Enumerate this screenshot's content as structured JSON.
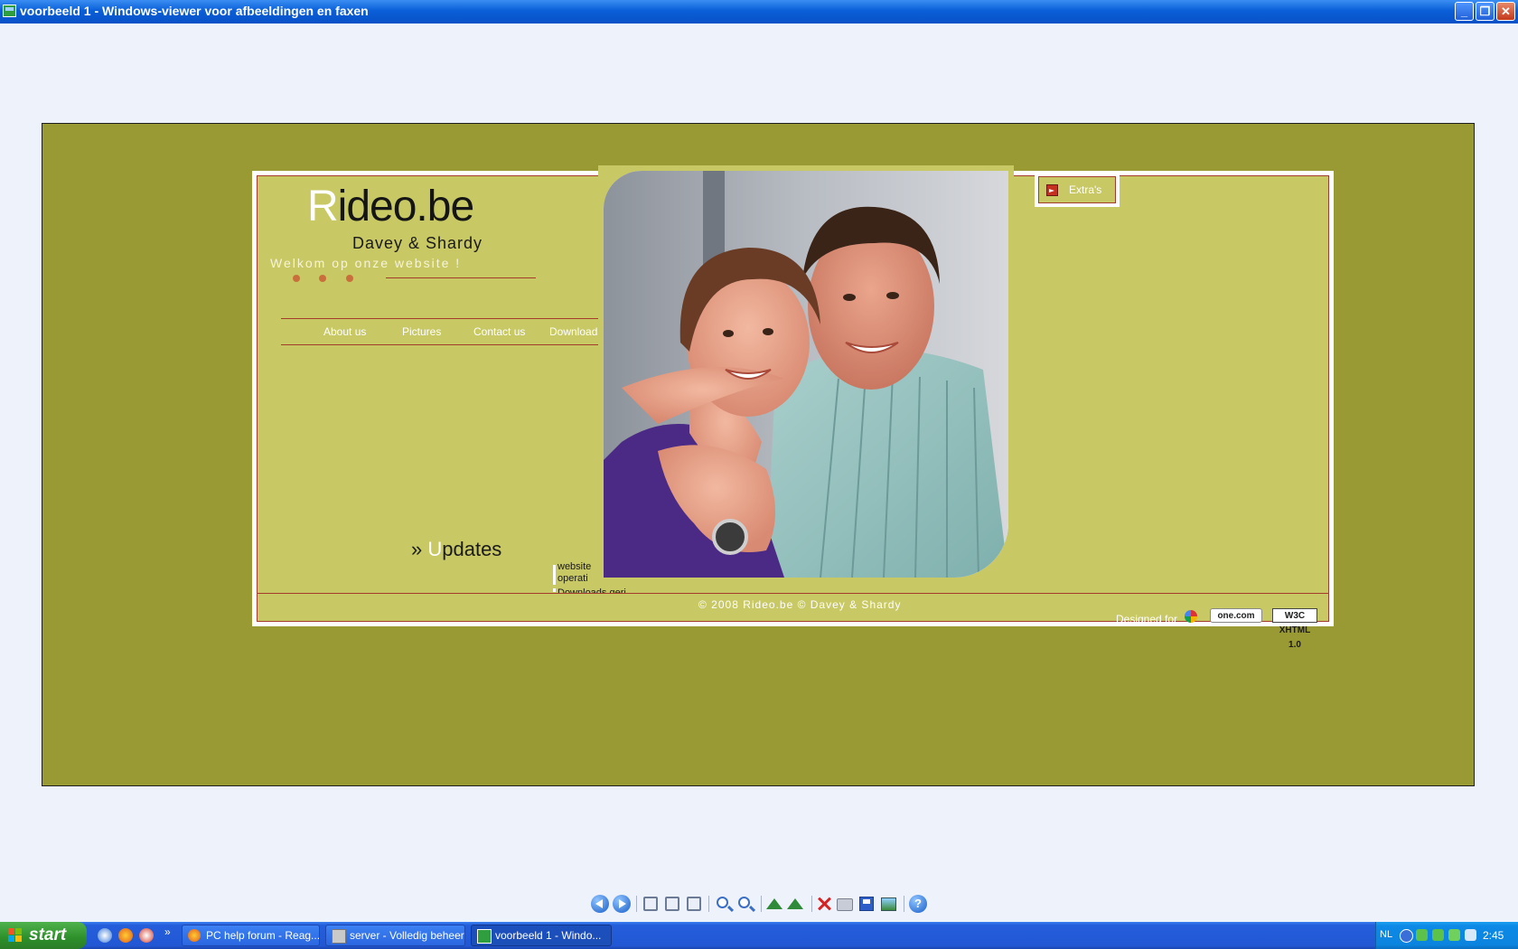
{
  "window": {
    "title": "voorbeeld 1 - Windows-viewer voor afbeeldingen en faxen",
    "minimize_glyph": "_",
    "restore_glyph": "❐",
    "close_glyph": "✕"
  },
  "website": {
    "logo_first": "R",
    "logo_rest": "ideo.be",
    "subtitle": "Davey & Shardy",
    "welcome": "Welkom op onze website !",
    "nav": [
      "About us",
      "Pictures",
      "Contact us",
      "Downloads"
    ],
    "extras_label": "Extra's",
    "updates_prefix": "» ",
    "updates_first": "U",
    "updates_rest": "pdates",
    "update_lines": [
      "website",
      "operati",
      "Downloads geri"
    ],
    "copyright": "© 2008 Rideo.be © Davey & Shardy",
    "designed_for": "Designed for",
    "badge_onecom": "one.com",
    "badge_w3c": "W3C XHTML 1.0"
  },
  "toolbar": {
    "icons": [
      "previous-image-icon",
      "next-image-icon",
      "best-fit-icon",
      "actual-size-icon",
      "slideshow-icon",
      "zoom-in-icon",
      "zoom-out-icon",
      "rotate-clockwise-icon",
      "rotate-counterclockwise-icon",
      "delete-icon",
      "print-icon",
      "save-icon",
      "edit-icon",
      "help-icon"
    ],
    "help_glyph": "?"
  },
  "taskbar": {
    "start_label": "start",
    "quick_launch_more": "»",
    "tasks": [
      {
        "label": "PC help forum - Reag..."
      },
      {
        "label": "server - Volledig beheer"
      },
      {
        "label": "voorbeeld 1 - Windo..."
      }
    ],
    "language": "NL",
    "clock": "2:45"
  },
  "colors": {
    "viewer_bg": "#eef2fb",
    "image_bg": "#9a9a34",
    "site_bg": "#c8c864",
    "site_line": "#a33c2c",
    "title_bar": "#0a5fd8",
    "taskbar": "#2257d4"
  }
}
